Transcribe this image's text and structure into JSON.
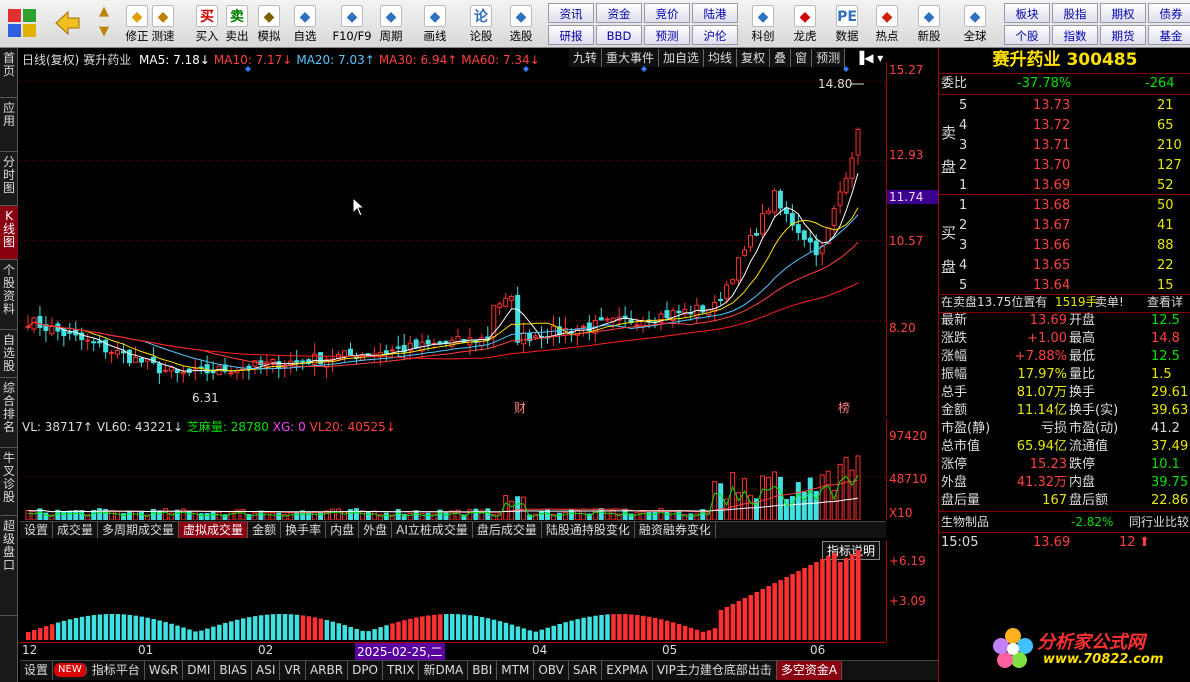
{
  "toolbar": {
    "items": [
      {
        "label": "修正",
        "icon": "up-arrow-icon"
      },
      {
        "label": "测速",
        "icon": "clock-icon"
      },
      {
        "label": "买入",
        "icon": "buy-icon",
        "glyph": "买"
      },
      {
        "label": "卖出",
        "icon": "sell-icon",
        "glyph": "卖"
      },
      {
        "label": "模拟",
        "icon": "hammer-icon"
      },
      {
        "label": "自选",
        "icon": "star-icon"
      },
      {
        "label": "F10/F9",
        "icon": "f10-icon"
      },
      {
        "label": "周期",
        "icon": "cycle-icon"
      },
      {
        "label": "画线",
        "icon": "pencil-icon"
      },
      {
        "label": "论股",
        "icon": "chat-icon",
        "glyph": "论"
      },
      {
        "label": "选股",
        "icon": "chart-search-icon"
      },
      {
        "label": "科创",
        "icon": "kechuang-icon"
      },
      {
        "label": "龙虎",
        "icon": "dragon-icon"
      },
      {
        "label": "数据",
        "icon": "data-icon",
        "glyph": "PE"
      },
      {
        "label": "热点",
        "icon": "fire-icon"
      },
      {
        "label": "新股",
        "icon": "ipo-icon"
      },
      {
        "label": "全球",
        "icon": "globe-icon"
      }
    ],
    "small_buttons": [
      "资讯",
      "资金",
      "竞价",
      "陆港",
      "研报",
      "BBD",
      "预测",
      "沪伦",
      "板块",
      "股指",
      "期权",
      "债券",
      "个股",
      "指数",
      "期货",
      "基金"
    ]
  },
  "leftnav": [
    "首页",
    "应用",
    "分时图",
    "K线图",
    "个股资料",
    "自选股",
    "综合排名",
    "牛叉诊股",
    "超级盘口"
  ],
  "chart": {
    "title": "日线(复权)",
    "name": "赛升药业",
    "ma": [
      {
        "label": "MA5: 7.18↓",
        "color": "#ffffff"
      },
      {
        "label": "MA10: 7.17↓",
        "color": "#ff4040"
      },
      {
        "label": "MA20: 7.03↑",
        "color": "#55c8ff"
      },
      {
        "label": "MA30: 6.94↑",
        "color": "#ff4040"
      },
      {
        "label": "MA60: 7.34↓",
        "color": "#ff4040"
      }
    ],
    "menu": [
      "九转",
      "重大事件",
      "加自选",
      "均线",
      "复权",
      "叠",
      "窗",
      "预测"
    ],
    "y_labels": [
      "15.27",
      "12.93",
      "10.57",
      "8.20"
    ],
    "current_price": "11.74",
    "high_label": "14.80",
    "low_label": "6.31",
    "markers": [
      "财",
      "榜"
    ]
  },
  "volume": {
    "vl": "VL: 38717↑",
    "vl60": "VL60: 43221↓",
    "zm": "芝麻量: 28780",
    "xg": "XG: 0",
    "vl20": "VL20: 40525↓",
    "y_labels": [
      "97420",
      "48710"
    ],
    "unit": "X10"
  },
  "vol_tabs": [
    "设置",
    "成交量",
    "多周期成交量",
    "虚拟成交量",
    "金额",
    "换手率",
    "内盘",
    "外盘",
    "AI立桩成交量",
    "盘后成交量",
    "陆股通持股变化",
    "融资融券变化"
  ],
  "indicator": {
    "help": "指标说明",
    "y_labels": [
      "+6.19",
      "+3.09"
    ],
    "x_labels": [
      "12",
      "01",
      "02",
      "2025-02-25,二",
      "04",
      "05",
      "06"
    ]
  },
  "bottom_tabs": [
    "设置",
    "指标平台",
    "W&R",
    "DMI",
    "BIAS",
    "ASI",
    "VR",
    "ARBR",
    "DPO",
    "TRIX",
    "新DMA",
    "BBI",
    "MTM",
    "OBV",
    "SAR",
    "EXPMA",
    "VIP主力建仓底部出击",
    "多空资金A"
  ],
  "bottom_new": "NEW",
  "quote": {
    "name": "赛升药业",
    "code": "300485",
    "weibi_label": "委比",
    "weibi": "-37.78%",
    "weicha": "-264",
    "sell_label": "卖盘",
    "buy_label": "买盘",
    "sells": [
      {
        "n": "5",
        "p": "13.73",
        "v": "21"
      },
      {
        "n": "4",
        "p": "13.72",
        "v": "65"
      },
      {
        "n": "3",
        "p": "13.71",
        "v": "210"
      },
      {
        "n": "2",
        "p": "13.70",
        "v": "127"
      },
      {
        "n": "1",
        "p": "13.69",
        "v": "52"
      }
    ],
    "buys": [
      {
        "n": "1",
        "p": "13.68",
        "v": "50"
      },
      {
        "n": "2",
        "p": "13.67",
        "v": "41"
      },
      {
        "n": "3",
        "p": "13.66",
        "v": "88"
      },
      {
        "n": "4",
        "p": "13.65",
        "v": "22"
      },
      {
        "n": "5",
        "p": "13.64",
        "v": "15"
      }
    ],
    "status": "在卖盘13.75位置有",
    "status_vol": "1519手",
    "status_sig": "卖单!",
    "status_link": "查看详",
    "stats": [
      [
        "最新",
        "13.69",
        "开盘",
        "12.5"
      ],
      [
        "涨跌",
        "+1.00",
        "最高",
        "14.8"
      ],
      [
        "涨幅",
        "+7.88%",
        "最低",
        "12.5"
      ],
      [
        "振幅",
        "17.97%",
        "量比",
        "1.5"
      ],
      [
        "总手",
        "81.07万",
        "换手",
        "29.61"
      ],
      [
        "金额",
        "11.14亿",
        "换手(实)",
        "39.63"
      ],
      [
        "市盈(静)",
        "亏损",
        "市盈(动)",
        "41.2"
      ],
      [
        "总市值",
        "65.94亿",
        "流通值",
        "37.49"
      ],
      [
        "涨停",
        "15.23",
        "跌停",
        "10.1"
      ],
      [
        "外盘",
        "41.32万",
        "内盘",
        "39.75"
      ],
      [
        "盘后量",
        "167",
        "盘后额",
        "22.86"
      ]
    ],
    "industry": "生物制品",
    "industry_pct": "-2.82%",
    "industry_link": "同行业比较",
    "tick_time": "15:05",
    "tick_price": "13.69",
    "tick_vol": "12"
  },
  "watermark": {
    "text": "分析家公式网",
    "url": "www.70822.com"
  }
}
